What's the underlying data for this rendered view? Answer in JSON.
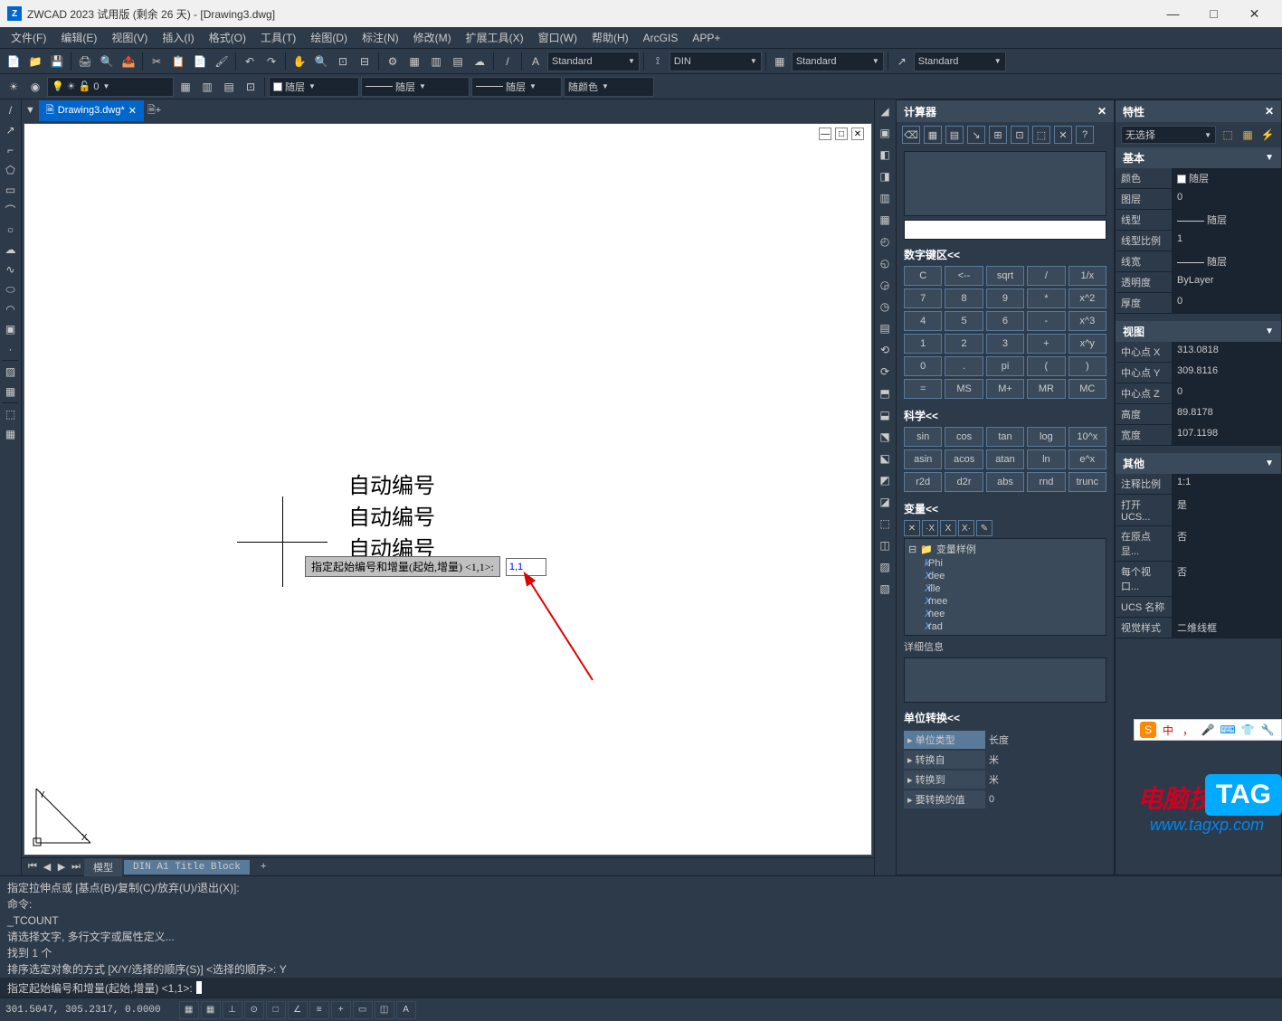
{
  "title": "ZWCAD 2023 试用版 (剩余 26 天) - [Drawing3.dwg]",
  "app_icon_text": "Z",
  "window_controls": {
    "min": "—",
    "max": "□",
    "close": "✕"
  },
  "menu": [
    "文件(F)",
    "编辑(E)",
    "视图(V)",
    "插入(I)",
    "格式(O)",
    "工具(T)",
    "绘图(D)",
    "标注(N)",
    "修改(M)",
    "扩展工具(X)",
    "窗口(W)",
    "帮助(H)",
    "ArcGIS",
    "APP+"
  ],
  "toolbar1": {
    "style1": "Standard",
    "style2": "DIN",
    "style3": "Standard",
    "style4": "Standard"
  },
  "toolbar2": {
    "layer_dd1": "随层",
    "layer_dd2": "随层",
    "layer_dd3": "随层",
    "color_dd": "随颜色"
  },
  "doc_tab": {
    "name": "Drawing3.dwg*"
  },
  "canvas": {
    "text1": "自动编号",
    "text2": "自动编号",
    "text3": "自动编号",
    "prompt_label": "指定起始编号和增量(起始,增量) <1,1>:",
    "prompt_value": "1,1",
    "canvas_ctrl_min": "—",
    "canvas_ctrl_max": "□",
    "canvas_ctrl_close": "✕"
  },
  "view_tabs": {
    "model": "模型",
    "layout1": "DIN A1 Title Block",
    "add": "+"
  },
  "right_tools": [
    "◢",
    "▣",
    "◧",
    "◨",
    "▥",
    "▦",
    "◴",
    "◵",
    "◶",
    "◷",
    "▤",
    "⟲",
    "⟳",
    "⬒",
    "⬓",
    "⬔",
    "⬕",
    "◩",
    "◪",
    "⬚",
    "◫",
    "▨",
    "▧"
  ],
  "calc": {
    "title": "计算器",
    "toolbar": [
      "⌫",
      "▦",
      "▤",
      "↘",
      "⊞",
      "⊡",
      "⬚",
      "✕",
      "?"
    ],
    "numpad_title": "数字键区<<",
    "numpad": [
      [
        "C",
        "<--",
        "sqrt",
        "/",
        "1/x"
      ],
      [
        "7",
        "8",
        "9",
        "*",
        "x^2"
      ],
      [
        "4",
        "5",
        "6",
        "-",
        "x^3"
      ],
      [
        "1",
        "2",
        "3",
        "+",
        "x^y"
      ],
      [
        "0",
        ".",
        "pi",
        "(",
        ")"
      ],
      [
        "=",
        "MS",
        "M+",
        "MR",
        "MC"
      ]
    ],
    "sci_title": "科学<<",
    "sci": [
      [
        "sin",
        "cos",
        "tan",
        "log",
        "10^x"
      ],
      [
        "asin",
        "acos",
        "atan",
        "ln",
        "e^x"
      ],
      [
        "r2d",
        "d2r",
        "abs",
        "rnd",
        "trunc"
      ]
    ],
    "var_title": "变量<<",
    "var_toolbar": [
      "✕",
      "·X",
      "X",
      "X·",
      "✎"
    ],
    "var_tree_root": "变量样例",
    "var_tree": [
      {
        "icon": "k",
        "name": "Phi"
      },
      {
        "icon": "X",
        "name": "dee"
      },
      {
        "icon": "X",
        "name": "ille"
      },
      {
        "icon": "X",
        "name": "mee"
      },
      {
        "icon": "X",
        "name": "nee"
      },
      {
        "icon": "X",
        "name": "rad"
      }
    ],
    "detail_title": "详细信息",
    "unit_title": "单位转换<<",
    "unit_rows": [
      {
        "label": "单位类型",
        "value": "长度"
      },
      {
        "label": "转换自",
        "value": "米"
      },
      {
        "label": "转换到",
        "value": "米"
      },
      {
        "label": "要转换的值",
        "value": "0"
      }
    ]
  },
  "props": {
    "title": "特性",
    "select": "无选择",
    "groups": [
      {
        "title": "基本",
        "rows": [
          {
            "label": "颜色",
            "value": "随层",
            "swatch": "color"
          },
          {
            "label": "图层",
            "value": "0"
          },
          {
            "label": "线型",
            "value": "随层",
            "swatch": "line"
          },
          {
            "label": "线型比例",
            "value": "1"
          },
          {
            "label": "线宽",
            "value": "随层",
            "swatch": "line"
          },
          {
            "label": "透明度",
            "value": "ByLayer"
          },
          {
            "label": "厚度",
            "value": "0"
          }
        ]
      },
      {
        "title": "视图",
        "rows": [
          {
            "label": "中心点 X",
            "value": "313.0818"
          },
          {
            "label": "中心点 Y",
            "value": "309.8116"
          },
          {
            "label": "中心点 Z",
            "value": "0"
          },
          {
            "label": "高度",
            "value": "89.8178"
          },
          {
            "label": "宽度",
            "value": "107.1198"
          }
        ]
      },
      {
        "title": "其他",
        "rows": [
          {
            "label": "注释比例",
            "value": "1:1"
          },
          {
            "label": "打开 UCS...",
            "value": "是"
          },
          {
            "label": "在原点显...",
            "value": "否"
          },
          {
            "label": "每个视口...",
            "value": "否"
          },
          {
            "label": "UCS 名称",
            "value": ""
          },
          {
            "label": "视觉样式",
            "value": "二维线框"
          }
        ]
      }
    ]
  },
  "cmdline": {
    "lines": [
      "指定拉伸点或 [基点(B)/复制(C)/放弃(U)/退出(X)]:",
      "命令:",
      "_TCOUNT",
      "请选择文字, 多行文字或属性定义...",
      "找到 1 个",
      "排序选定对象的方式 [X/Y/选择的顺序(S)] <选择的顺序>: Y"
    ],
    "prompt": "指定起始编号和增量(起始,增量) <1,1>:"
  },
  "status": {
    "coords": "301.5047, 305.2317, 0.0000"
  },
  "ime": {
    "cn": "中"
  },
  "watermark": {
    "line1": "电脑技术网",
    "line2": "www.tagxp.com",
    "tag": "TAG"
  }
}
